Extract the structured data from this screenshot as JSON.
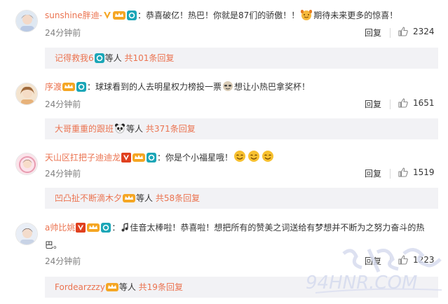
{
  "comments": [
    {
      "username": "sunshine胖迪-",
      "colon": "：",
      "text_parts": [
        "恭喜破亿！热巴！你就是87们的骄傲！！",
        "期待未来更多的惊喜！"
      ],
      "time": "24分钟前",
      "reply_label": "回复",
      "likes": "2324",
      "replies_box": {
        "user": "记得救我6",
        "mid": "等人",
        "total": "共101条回复"
      }
    },
    {
      "username": "序渡",
      "colon": "：",
      "text_parts": [
        "球球看到的人去明星权力榜投一票",
        "想让小热巴拿奖杯！"
      ],
      "time": "24分钟前",
      "reply_label": "回复",
      "likes": "1651",
      "replies_box": {
        "user": "大哥重重的跟班",
        "mid": "等人",
        "total": "共371条回复"
      }
    },
    {
      "username": "天山区扛把子迪迪龙",
      "colon": "：",
      "text_parts": [
        "你是个小福星哦！"
      ],
      "time": "24分钟前",
      "reply_label": "回复",
      "likes": "1519",
      "replies_box": {
        "user": "凹凸扯不断滴木夕",
        "mid": "等人",
        "total": "共58条回复"
      }
    },
    {
      "username": "a帅比姚",
      "colon": "：",
      "text_parts": [
        "佳音太棒啦！恭喜啦！想把所有的赞美之词送给有梦想并不断为之努力奋斗的热巴。"
      ],
      "time": "24分钟前",
      "reply_label": "回复",
      "likes": "1223",
      "replies_box": {
        "user": "Fordearzzzy",
        "mid": "等人",
        "total": "共19条回复"
      }
    }
  ],
  "colors": {
    "username": "#eb7350",
    "reply_bg": "#f2f2f5",
    "time": "#808080",
    "vip": "#f5a623",
    "fan_badge": "#1aa6b7",
    "verified_red": "#e0401f"
  },
  "watermark": {
    "text": "94HNR.COM",
    "logo_text": "环球"
  }
}
